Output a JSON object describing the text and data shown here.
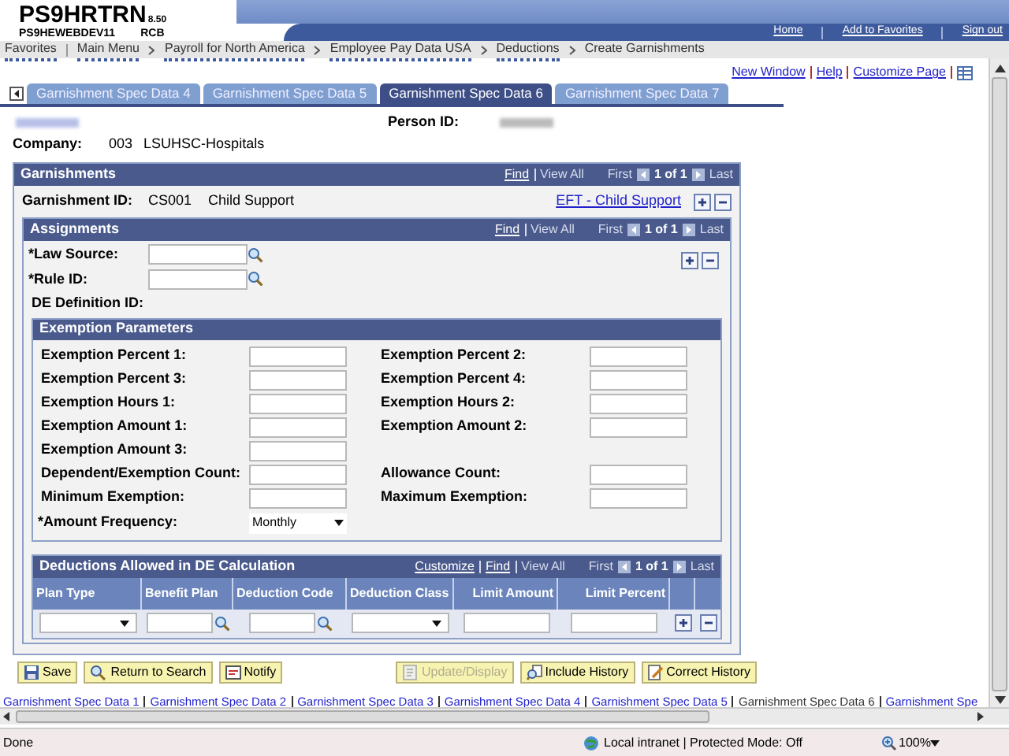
{
  "header": {
    "system": "PS9HRTRN",
    "version": "8.50",
    "database": "PS9HEWEBDEV11",
    "user": "RCB",
    "links": [
      "Home",
      "Add to Favorites",
      "Sign out"
    ]
  },
  "breadcrumbs": [
    {
      "label": "Favorites",
      "menu": true
    },
    {
      "label": "Main Menu",
      "menu": true
    },
    {
      "label": "Payroll for North America",
      "menu": true
    },
    {
      "label": "Employee Pay Data USA",
      "menu": true
    },
    {
      "label": "Deductions",
      "menu": true
    },
    {
      "label": "Create Garnishments",
      "menu": false
    }
  ],
  "page_links": [
    "New Window",
    "Help",
    "Customize Page"
  ],
  "tabs": [
    {
      "label": "Garnishment Spec Data 4",
      "selected": false
    },
    {
      "label": "Garnishment Spec Data 5",
      "selected": false
    },
    {
      "label": "Garnishment Spec Data 6",
      "selected": true
    },
    {
      "label": "Garnishment Spec Data 7",
      "selected": false
    }
  ],
  "person": {
    "person_id_label": "Person ID:",
    "company_label": "Company:",
    "company_code": "003",
    "company_name": "LSUHSC-Hospitals"
  },
  "garnishments": {
    "title": "Garnishments",
    "find": "Find",
    "view_all": "View All",
    "first": "First",
    "count": "1 of 1",
    "last": "Last",
    "id_label": "Garnishment ID:",
    "id": "CS001",
    "description": "Child Support",
    "link": "EFT - Child Support"
  },
  "assignments": {
    "title": "Assignments",
    "find": "Find",
    "view_all": "View All",
    "first": "First",
    "count": "1 of 1",
    "last": "Last",
    "law_source_label": "*Law Source:",
    "rule_id_label": "*Rule ID:",
    "de_definition_label": "DE Definition ID:"
  },
  "exemption_parameters": {
    "title": "Exemption Parameters",
    "rows": [
      [
        "Exemption Percent 1:",
        "Exemption Percent 2:"
      ],
      [
        "Exemption Percent 3:",
        "Exemption Percent 4:"
      ],
      [
        "Exemption Hours 1:",
        "Exemption Hours 2:"
      ],
      [
        "Exemption Amount 1:",
        "Exemption Amount 2:"
      ],
      [
        "Exemption Amount 3:"
      ],
      [
        "Dependent/Exemption Count:",
        "Allowance Count:"
      ],
      [
        "Minimum Exemption:",
        "Maximum Exemption:"
      ]
    ],
    "frequency_label": "*Amount Frequency:",
    "frequency_value": "Monthly"
  },
  "deductions_grid": {
    "title": "Deductions Allowed in DE Calculation",
    "customize": "Customize",
    "find": "Find",
    "view_all": "View All",
    "first": "First",
    "count": "1 of 1",
    "last": "Last",
    "columns": [
      {
        "label": "Plan Type",
        "kind": "select"
      },
      {
        "label": "Benefit Plan",
        "kind": "lookup"
      },
      {
        "label": "Deduction Code",
        "kind": "lookup"
      },
      {
        "label": "Deduction Class",
        "kind": "select"
      },
      {
        "label": "Limit Amount",
        "kind": "text"
      },
      {
        "label": "Limit Percent",
        "kind": "text"
      }
    ]
  },
  "buttons": [
    {
      "label": "Save",
      "disabled": false
    },
    {
      "label": "Return to Search",
      "disabled": false
    },
    {
      "label": "Notify",
      "disabled": false
    },
    {
      "label": "Update/Display",
      "disabled": true
    },
    {
      "label": "Include History",
      "disabled": false
    },
    {
      "label": "Correct History",
      "disabled": false
    }
  ],
  "bottom_links": [
    {
      "label": "Garnishment Spec Data 1",
      "selected": false
    },
    {
      "label": "Garnishment Spec Data 2",
      "selected": false
    },
    {
      "label": "Garnishment Spec Data 3",
      "selected": false
    },
    {
      "label": "Garnishment Spec Data 4",
      "selected": false
    },
    {
      "label": "Garnishment Spec Data 5",
      "selected": false
    },
    {
      "label": "Garnishment Spec Data 6",
      "selected": true
    },
    {
      "label": "Garnishment Spe",
      "selected": false
    }
  ],
  "status_bar": {
    "text": "Done",
    "zone": "Local intranet | Protected Mode: Off",
    "zoom": "100%"
  }
}
